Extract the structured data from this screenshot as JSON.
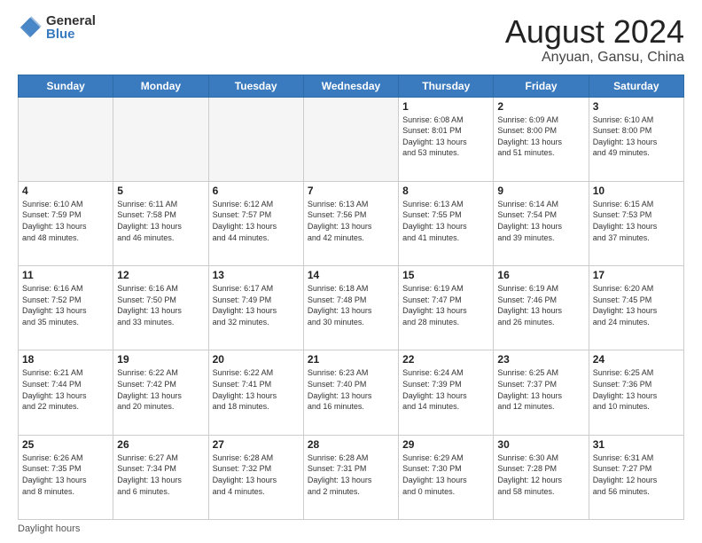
{
  "header": {
    "logo_general": "General",
    "logo_blue": "Blue",
    "month_title": "August 2024",
    "location": "Anyuan, Gansu, China"
  },
  "days_of_week": [
    "Sunday",
    "Monday",
    "Tuesday",
    "Wednesday",
    "Thursday",
    "Friday",
    "Saturday"
  ],
  "footer_note": "Daylight hours",
  "weeks": [
    [
      {
        "num": "",
        "info": ""
      },
      {
        "num": "",
        "info": ""
      },
      {
        "num": "",
        "info": ""
      },
      {
        "num": "",
        "info": ""
      },
      {
        "num": "1",
        "info": "Sunrise: 6:08 AM\nSunset: 8:01 PM\nDaylight: 13 hours\nand 53 minutes."
      },
      {
        "num": "2",
        "info": "Sunrise: 6:09 AM\nSunset: 8:00 PM\nDaylight: 13 hours\nand 51 minutes."
      },
      {
        "num": "3",
        "info": "Sunrise: 6:10 AM\nSunset: 8:00 PM\nDaylight: 13 hours\nand 49 minutes."
      }
    ],
    [
      {
        "num": "4",
        "info": "Sunrise: 6:10 AM\nSunset: 7:59 PM\nDaylight: 13 hours\nand 48 minutes."
      },
      {
        "num": "5",
        "info": "Sunrise: 6:11 AM\nSunset: 7:58 PM\nDaylight: 13 hours\nand 46 minutes."
      },
      {
        "num": "6",
        "info": "Sunrise: 6:12 AM\nSunset: 7:57 PM\nDaylight: 13 hours\nand 44 minutes."
      },
      {
        "num": "7",
        "info": "Sunrise: 6:13 AM\nSunset: 7:56 PM\nDaylight: 13 hours\nand 42 minutes."
      },
      {
        "num": "8",
        "info": "Sunrise: 6:13 AM\nSunset: 7:55 PM\nDaylight: 13 hours\nand 41 minutes."
      },
      {
        "num": "9",
        "info": "Sunrise: 6:14 AM\nSunset: 7:54 PM\nDaylight: 13 hours\nand 39 minutes."
      },
      {
        "num": "10",
        "info": "Sunrise: 6:15 AM\nSunset: 7:53 PM\nDaylight: 13 hours\nand 37 minutes."
      }
    ],
    [
      {
        "num": "11",
        "info": "Sunrise: 6:16 AM\nSunset: 7:52 PM\nDaylight: 13 hours\nand 35 minutes."
      },
      {
        "num": "12",
        "info": "Sunrise: 6:16 AM\nSunset: 7:50 PM\nDaylight: 13 hours\nand 33 minutes."
      },
      {
        "num": "13",
        "info": "Sunrise: 6:17 AM\nSunset: 7:49 PM\nDaylight: 13 hours\nand 32 minutes."
      },
      {
        "num": "14",
        "info": "Sunrise: 6:18 AM\nSunset: 7:48 PM\nDaylight: 13 hours\nand 30 minutes."
      },
      {
        "num": "15",
        "info": "Sunrise: 6:19 AM\nSunset: 7:47 PM\nDaylight: 13 hours\nand 28 minutes."
      },
      {
        "num": "16",
        "info": "Sunrise: 6:19 AM\nSunset: 7:46 PM\nDaylight: 13 hours\nand 26 minutes."
      },
      {
        "num": "17",
        "info": "Sunrise: 6:20 AM\nSunset: 7:45 PM\nDaylight: 13 hours\nand 24 minutes."
      }
    ],
    [
      {
        "num": "18",
        "info": "Sunrise: 6:21 AM\nSunset: 7:44 PM\nDaylight: 13 hours\nand 22 minutes."
      },
      {
        "num": "19",
        "info": "Sunrise: 6:22 AM\nSunset: 7:42 PM\nDaylight: 13 hours\nand 20 minutes."
      },
      {
        "num": "20",
        "info": "Sunrise: 6:22 AM\nSunset: 7:41 PM\nDaylight: 13 hours\nand 18 minutes."
      },
      {
        "num": "21",
        "info": "Sunrise: 6:23 AM\nSunset: 7:40 PM\nDaylight: 13 hours\nand 16 minutes."
      },
      {
        "num": "22",
        "info": "Sunrise: 6:24 AM\nSunset: 7:39 PM\nDaylight: 13 hours\nand 14 minutes."
      },
      {
        "num": "23",
        "info": "Sunrise: 6:25 AM\nSunset: 7:37 PM\nDaylight: 13 hours\nand 12 minutes."
      },
      {
        "num": "24",
        "info": "Sunrise: 6:25 AM\nSunset: 7:36 PM\nDaylight: 13 hours\nand 10 minutes."
      }
    ],
    [
      {
        "num": "25",
        "info": "Sunrise: 6:26 AM\nSunset: 7:35 PM\nDaylight: 13 hours\nand 8 minutes."
      },
      {
        "num": "26",
        "info": "Sunrise: 6:27 AM\nSunset: 7:34 PM\nDaylight: 13 hours\nand 6 minutes."
      },
      {
        "num": "27",
        "info": "Sunrise: 6:28 AM\nSunset: 7:32 PM\nDaylight: 13 hours\nand 4 minutes."
      },
      {
        "num": "28",
        "info": "Sunrise: 6:28 AM\nSunset: 7:31 PM\nDaylight: 13 hours\nand 2 minutes."
      },
      {
        "num": "29",
        "info": "Sunrise: 6:29 AM\nSunset: 7:30 PM\nDaylight: 13 hours\nand 0 minutes."
      },
      {
        "num": "30",
        "info": "Sunrise: 6:30 AM\nSunset: 7:28 PM\nDaylight: 12 hours\nand 58 minutes."
      },
      {
        "num": "31",
        "info": "Sunrise: 6:31 AM\nSunset: 7:27 PM\nDaylight: 12 hours\nand 56 minutes."
      }
    ]
  ]
}
